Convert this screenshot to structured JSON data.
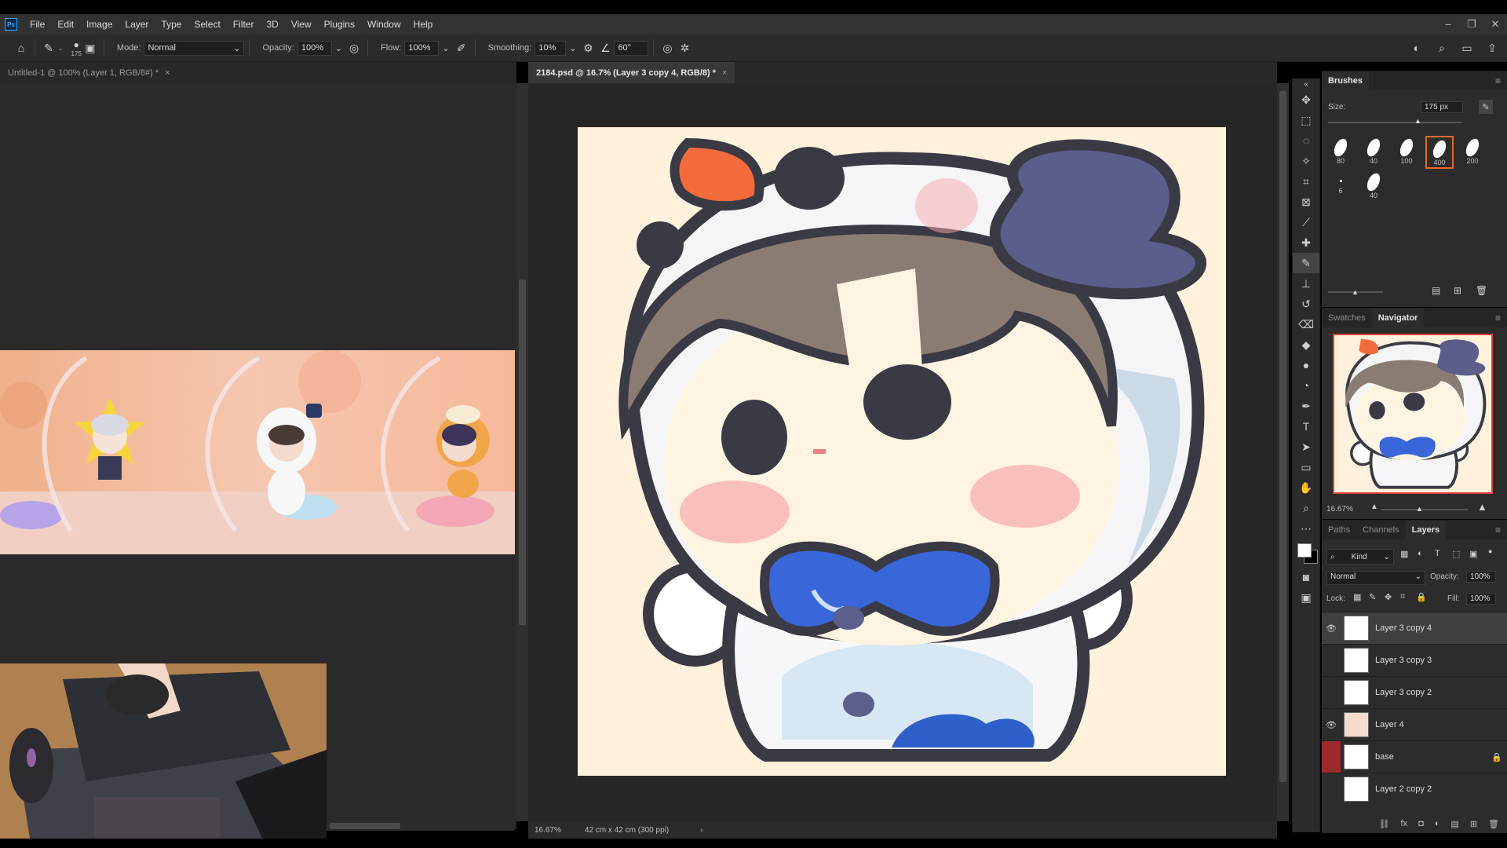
{
  "app": {
    "logo": "Ps"
  },
  "menu": [
    "File",
    "Edit",
    "Image",
    "Layer",
    "Type",
    "Select",
    "Filter",
    "3D",
    "View",
    "Plugins",
    "Window",
    "Help"
  ],
  "window_controls": [
    "–",
    "❐",
    "✕"
  ],
  "options": {
    "brush_size": "175",
    "mode_label": "Mode:",
    "mode_value": "Normal",
    "opacity_label": "Opacity:",
    "opacity_value": "100%",
    "flow_label": "Flow:",
    "flow_value": "100%",
    "smoothing_label": "Smoothing:",
    "smoothing_value": "10%",
    "angle_value": "60°"
  },
  "tabs": {
    "doc1": "Untitled-1 @ 100% (Layer 1, RGB/8#) *",
    "doc2": "2184.psd @ 16.7% (Layer 3 copy 4, RGB/8) *",
    "close": "×"
  },
  "status": {
    "zoom": "16.67%",
    "doc_info": "42 cm x 42 cm (300 ppi)",
    "arrow": "›"
  },
  "brushes_panel": {
    "title": "Brushes",
    "size_label": "Size:",
    "size_value": "175 px",
    "presets": [
      "80",
      "40",
      "100",
      "400",
      "200",
      "6",
      "40"
    ],
    "selected_index": 3
  },
  "navigator_panel": {
    "tabs": [
      "Swatches",
      "Navigator"
    ],
    "active": "Navigator",
    "zoom": "16.67%"
  },
  "layers_panel": {
    "tabs": [
      "Paths",
      "Channels",
      "Layers"
    ],
    "active": "Layers",
    "filter_kind": "Kind",
    "blend_mode": "Normal",
    "opacity_label": "Opacity:",
    "opacity_value": "100%",
    "lock_label": "Lock:",
    "fill_label": "Fill:",
    "fill_value": "100%",
    "layers": [
      {
        "name": "Layer 3 copy 4",
        "visible": true,
        "selected": true
      },
      {
        "name": "Layer 3 copy 3",
        "visible": false
      },
      {
        "name": "Layer 3 copy 2",
        "visible": false
      },
      {
        "name": "Layer 4",
        "visible": true
      },
      {
        "name": "base",
        "visible": false,
        "locked": true
      },
      {
        "name": "Layer 2 copy 2",
        "visible": false
      }
    ]
  },
  "colors": {
    "accent": "#e46a2a",
    "canvas_bg": "#fff1dc",
    "selected_layer": "#3f3f3f"
  }
}
